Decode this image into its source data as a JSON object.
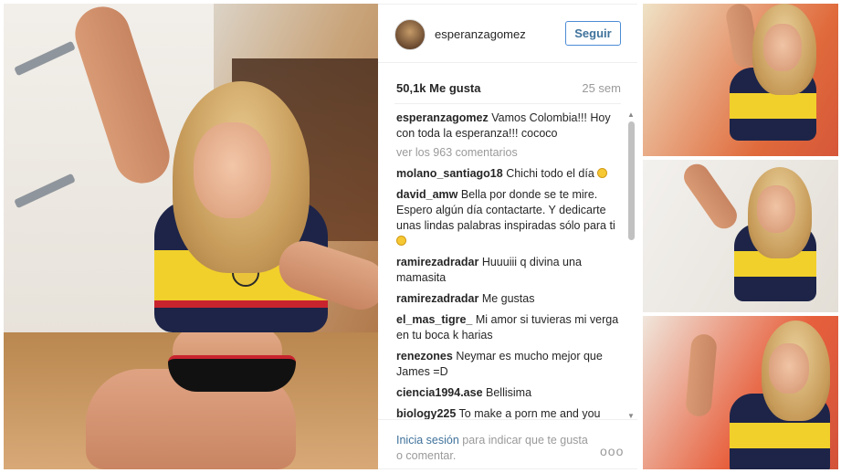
{
  "post": {
    "username": "esperanzagomez",
    "follow_label": "Seguir",
    "likes": "50,1k Me gusta",
    "time_ago": "25 sem",
    "caption": {
      "user": "esperanzagomez",
      "text": "Vamos Colombia!!! Hoy con toda la esperanza!!! cococo"
    },
    "view_all_comments": "ver los 963 comentarios",
    "comments": [
      {
        "user": "molano_santiago18",
        "text": "Chichi todo el día"
      },
      {
        "user": "david_amw",
        "text": "Bella por donde se te mire. Espero algún día contactarte. Y dedicarte unas lindas palabras inspiradas sólo para ti"
      },
      {
        "user": "ramirezadradar",
        "text": "Huuuiii q divina una mamasita"
      },
      {
        "user": "ramirezadradar",
        "text": "Me gustas"
      },
      {
        "user": "el_mas_tigre_",
        "text": "Mi amor si tuvieras mi verga en tu boca k harias"
      },
      {
        "user": "renezones",
        "text": "Neymar es mucho mejor que James =D"
      },
      {
        "user": "ciencia1994.ase",
        "text": "Bellisima"
      },
      {
        "user": "biology225",
        "text": "To make a porn me and you dress like that"
      }
    ],
    "footer": {
      "login_label": "Inicia sesión",
      "login_suffix": " para indicar que te gusta o comentar.",
      "more_label": "ooo"
    }
  },
  "scrollbar": {
    "up_arrow": "▲",
    "down_arrow": "▼"
  },
  "colors": {
    "link_blue": "#3f729b",
    "follow_border": "#4c8cd6",
    "muted_gray": "#9a9a9a",
    "jersey_navy": "#1d2448",
    "jersey_yellow": "#f1d02b",
    "jersey_red": "#c8242e"
  }
}
